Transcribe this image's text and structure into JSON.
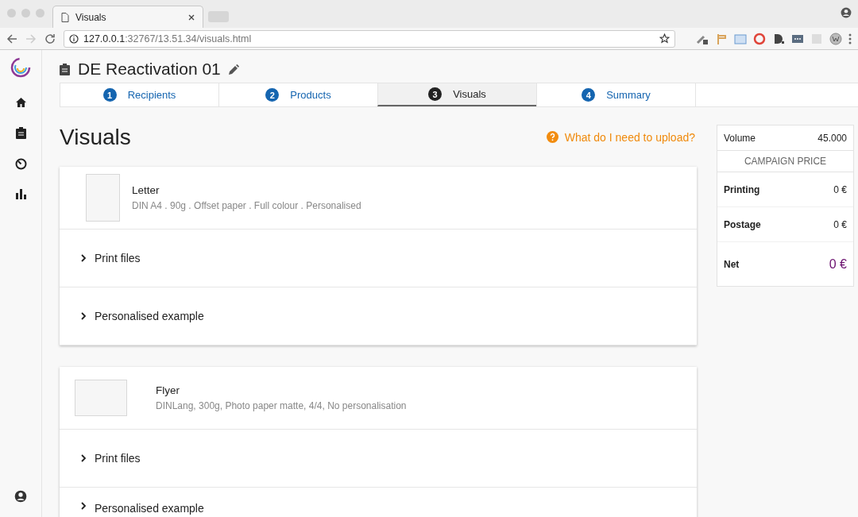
{
  "browser": {
    "tab_title": "Visuals",
    "url": "**127.0.0.1**:32767/13.51.34/visuals.html"
  },
  "campaign": {
    "title": "DE Reactivation 01"
  },
  "steps": [
    {
      "number": "1",
      "label": "Recipients",
      "selected": false
    },
    {
      "number": "2",
      "label": "Products",
      "selected": false
    },
    {
      "number": "3",
      "label": "Visuals",
      "selected": true
    },
    {
      "number": "4",
      "label": "Summary",
      "selected": false
    }
  ],
  "page": {
    "heading": "Visuals",
    "help_link": "What do I need to upload?"
  },
  "products": [
    {
      "name": "Letter",
      "spec": "DIN A4 . 90g . Offset paper . Full colour . Personalised",
      "kind": "portrait",
      "sections": [
        {
          "label": "Print files",
          "expanded": false
        },
        {
          "label": "Personalised example",
          "expanded": false
        }
      ]
    },
    {
      "name": "Flyer",
      "spec": "DINLang, 300g, Photo paper matte, 4/4, No personalisation",
      "kind": "landscape",
      "sections": [
        {
          "label": "Print files",
          "expanded": false
        },
        {
          "label": "Personalised example",
          "expanded": false
        }
      ]
    }
  ],
  "summary": {
    "volume_label": "Volume",
    "volume": "45.000",
    "heading": "CAMPAIGN PRICE",
    "rows": [
      {
        "label": "Printing",
        "value": "0 €"
      },
      {
        "label": "Postage",
        "value": "0 €"
      }
    ],
    "total_label": "Net",
    "total": "0 €"
  }
}
